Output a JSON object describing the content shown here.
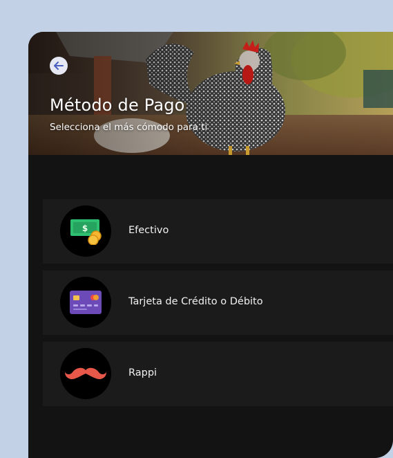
{
  "header": {
    "title": "Método de Pago",
    "subtitle": "Selecciona el más cómodo para ti"
  },
  "payment_options": [
    {
      "label": "Efectivo",
      "icon": "cash-icon"
    },
    {
      "label": "Tarjeta de Crédito o Débito",
      "icon": "credit-card-icon"
    },
    {
      "label": "Rappi",
      "icon": "mustache-icon"
    }
  ],
  "colors": {
    "background": "#c3d1e6",
    "screen": "#131313",
    "option_row": "#1b1b1b",
    "back_button_arrow": "#4a5fc1",
    "mustache": "#e8584a",
    "card": "#6c4bb8",
    "cash": "#2fbf71"
  }
}
